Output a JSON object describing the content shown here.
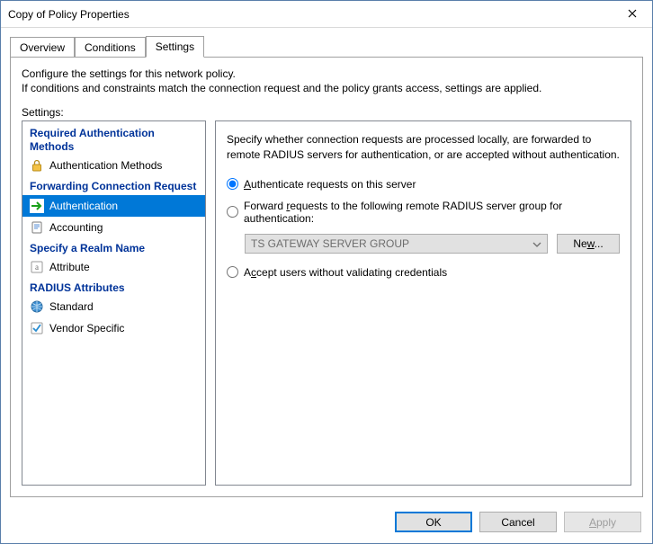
{
  "window": {
    "title": "Copy of Policy Properties"
  },
  "tabs": [
    {
      "label": "Overview",
      "active": false
    },
    {
      "label": "Conditions",
      "active": false
    },
    {
      "label": "Settings",
      "active": true
    }
  ],
  "intro": {
    "line1": "Configure the settings for this network policy.",
    "line2": "If conditions and constraints match the connection request and the policy grants access, settings are applied."
  },
  "settings_label": "Settings:",
  "sidebar": {
    "groups": [
      {
        "title": "Required Authentication Methods",
        "items": [
          {
            "icon": "lock-icon",
            "label": "Authentication Methods",
            "selected": false
          }
        ]
      },
      {
        "title": "Forwarding Connection Request",
        "items": [
          {
            "icon": "arrow-right-icon",
            "label": "Authentication",
            "selected": true
          },
          {
            "icon": "document-icon",
            "label": "Accounting",
            "selected": false
          }
        ]
      },
      {
        "title": "Specify a Realm Name",
        "items": [
          {
            "icon": "attribute-icon",
            "label": "Attribute",
            "selected": false
          }
        ]
      },
      {
        "title": "RADIUS Attributes",
        "items": [
          {
            "icon": "globe-icon",
            "label": "Standard",
            "selected": false
          },
          {
            "icon": "check-icon",
            "label": "Vendor Specific",
            "selected": false
          }
        ]
      }
    ]
  },
  "detail": {
    "description": "Specify whether connection requests are processed locally, are forwarded to remote RADIUS servers for authentication, or are accepted without authentication.",
    "radios": {
      "local": "Authenticate requests on this server",
      "forward_pre": "Forward ",
      "forward_u": "r",
      "forward_post": "equests to the following remote RADIUS server group for authentication:",
      "accept_pre": "A",
      "accept_u": "c",
      "accept_post": "cept users without validating credentials"
    },
    "combo_value": "TS GATEWAY SERVER GROUP",
    "new_button_pre": "Ne",
    "new_button_u": "w",
    "new_button_post": "..."
  },
  "footer": {
    "ok": "OK",
    "cancel": "Cancel",
    "apply": "Apply"
  }
}
